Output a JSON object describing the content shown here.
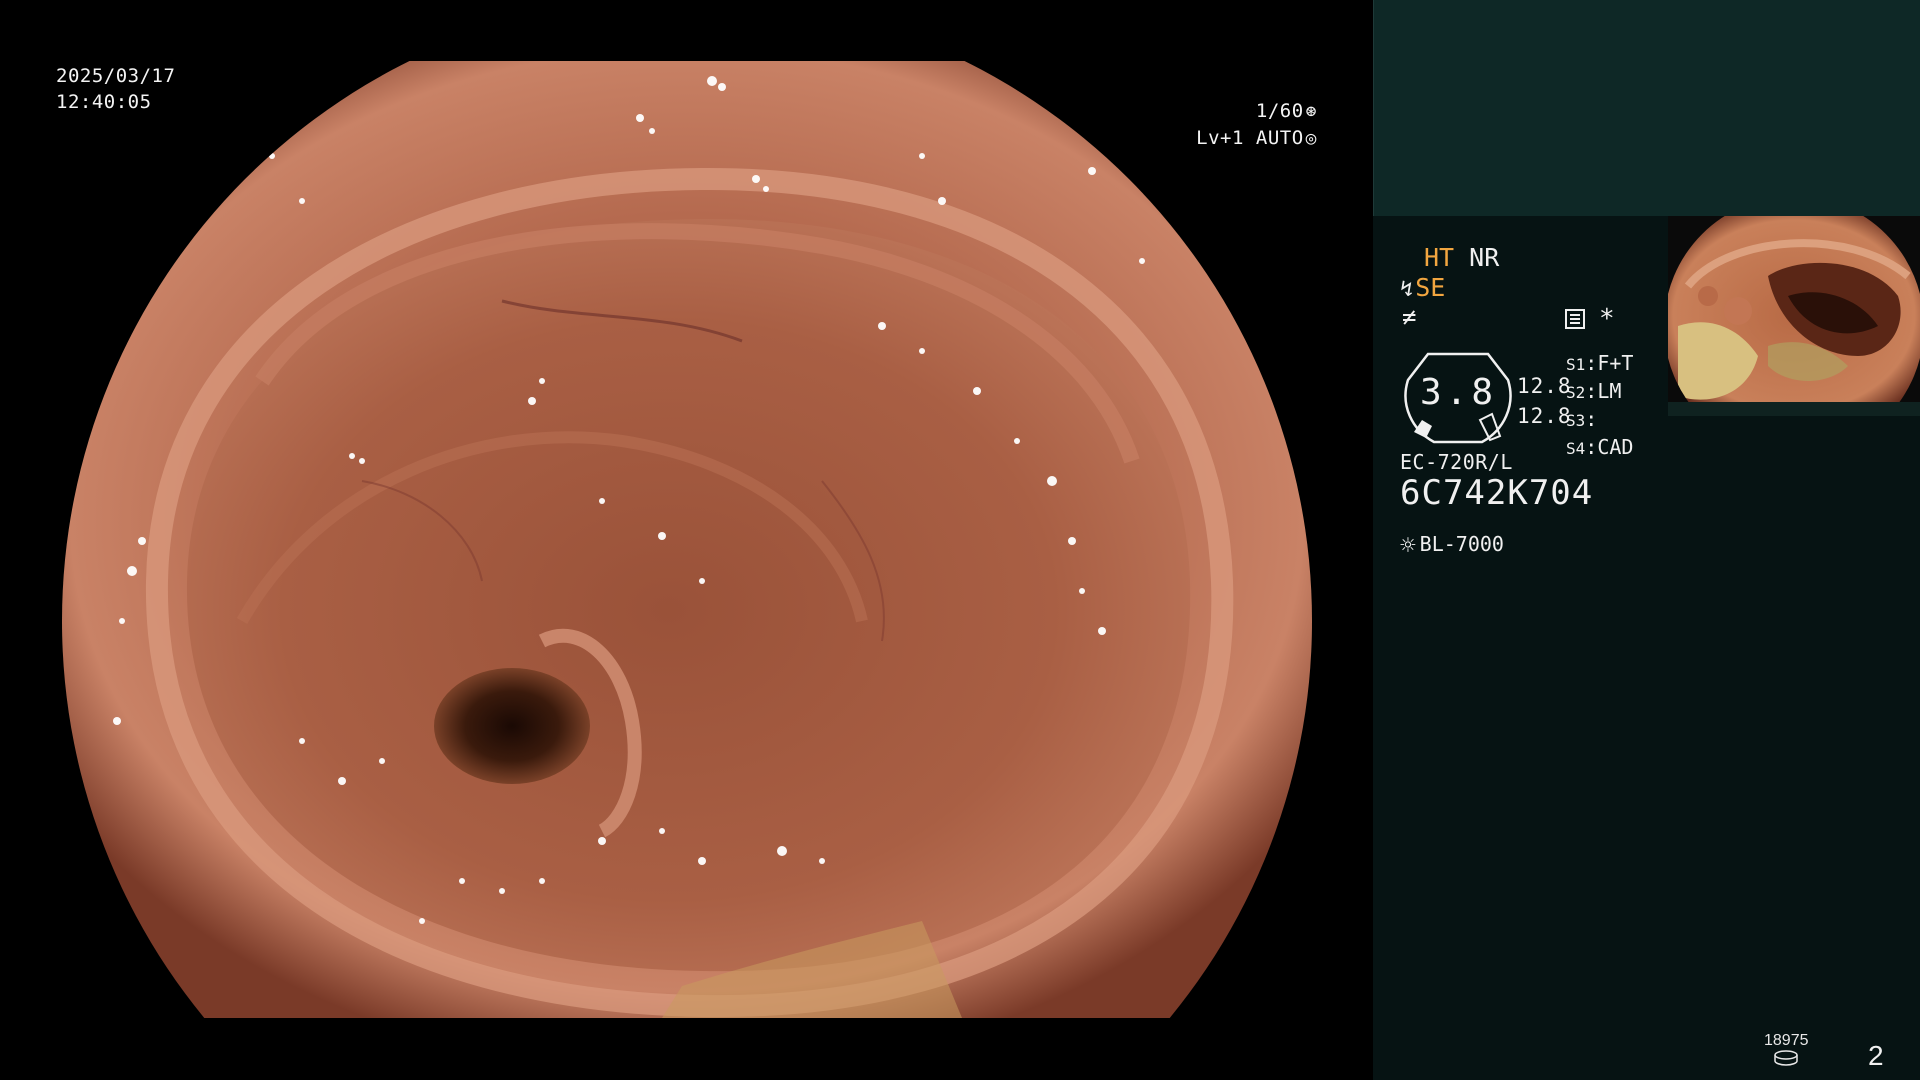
{
  "overlay": {
    "date": "2025/03/17",
    "time": "12:40:05",
    "shutter": "1/60",
    "shutter_icon": "aperture-icon",
    "level": "Lv+1",
    "mode": "AUTO",
    "mode_icon": "iris-icon"
  },
  "panel": {
    "ht_label": "HT",
    "nr_label": "NR",
    "se_label": "SE",
    "se_icon": "scope-tip-icon",
    "slash_icon": "not-equal-icon",
    "menu_icon": "settings-list-icon",
    "star_label": "*",
    "gauge": {
      "value": "3.8",
      "side_top": "12.8",
      "side_bottom": "12.8"
    },
    "switches": [
      {
        "key": "S1",
        "value": "F+T"
      },
      {
        "key": "S2",
        "value": "LM"
      },
      {
        "key": "S3",
        "value": ""
      },
      {
        "key": "S4",
        "value": "CAD"
      }
    ],
    "scope_model": "EC-720R/L",
    "scope_serial": "6C742K704",
    "light_source": "BL-7000",
    "light_icon": "lamp-sun-icon"
  },
  "footer": {
    "capture_count": "18975",
    "page_number": "2",
    "disk_icon": "storage-disk-icon"
  },
  "colors": {
    "accent_orange": "#f2a640",
    "panel_top": "#0e2826",
    "panel_body": "#061313",
    "mucosa": "#b56a4f"
  }
}
